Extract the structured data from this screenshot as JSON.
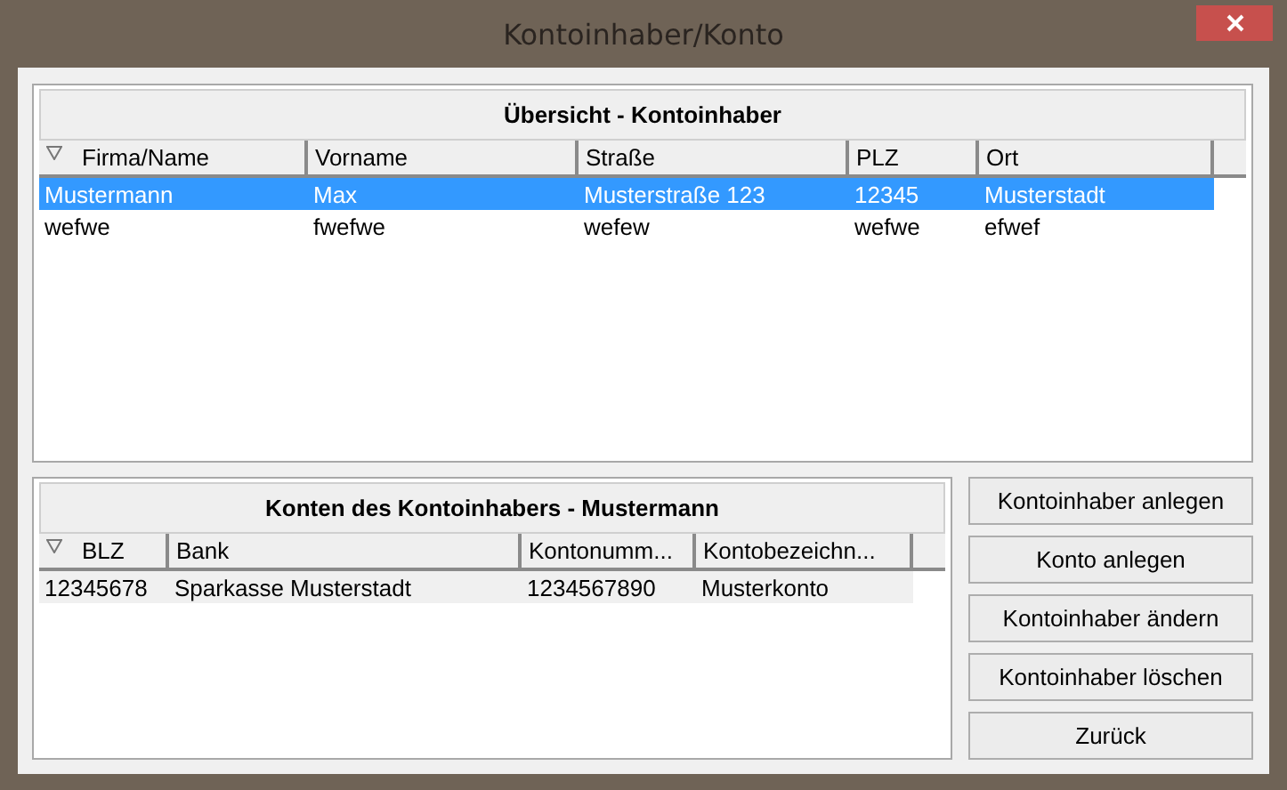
{
  "window": {
    "title": "Kontoinhaber/Konto"
  },
  "owners": {
    "title": "Übersicht - Kontoinhaber",
    "columns": [
      {
        "label": "Firma/Name",
        "sorted": true
      },
      {
        "label": "Vorname",
        "sorted": false
      },
      {
        "label": "Straße",
        "sorted": false
      },
      {
        "label": "PLZ",
        "sorted": false
      },
      {
        "label": "Ort",
        "sorted": false
      }
    ],
    "rows": [
      {
        "selected": true,
        "cells": [
          "Mustermann",
          "Max",
          "Musterstraße 123",
          "12345",
          "Musterstadt"
        ]
      },
      {
        "selected": false,
        "cells": [
          "wefwe",
          "fwefwe",
          "wefew",
          "wefwe",
          "efwef"
        ]
      }
    ]
  },
  "accounts": {
    "title": "Konten des Kontoinhabers - Mustermann",
    "columns": [
      {
        "label": "BLZ",
        "sorted": true
      },
      {
        "label": "Bank",
        "sorted": false
      },
      {
        "label": "Kontonumm...",
        "sorted": false
      },
      {
        "label": "Kontobezeichn...",
        "sorted": false
      }
    ],
    "rows": [
      {
        "selected": true,
        "cells": [
          "12345678",
          "Sparkasse Musterstadt",
          "1234567890",
          "Musterkonto"
        ]
      }
    ]
  },
  "buttons": [
    "Kontoinhaber anlegen",
    "Konto anlegen",
    "Kontoinhaber ändern",
    "Kontoinhaber löschen",
    "Zurück"
  ]
}
